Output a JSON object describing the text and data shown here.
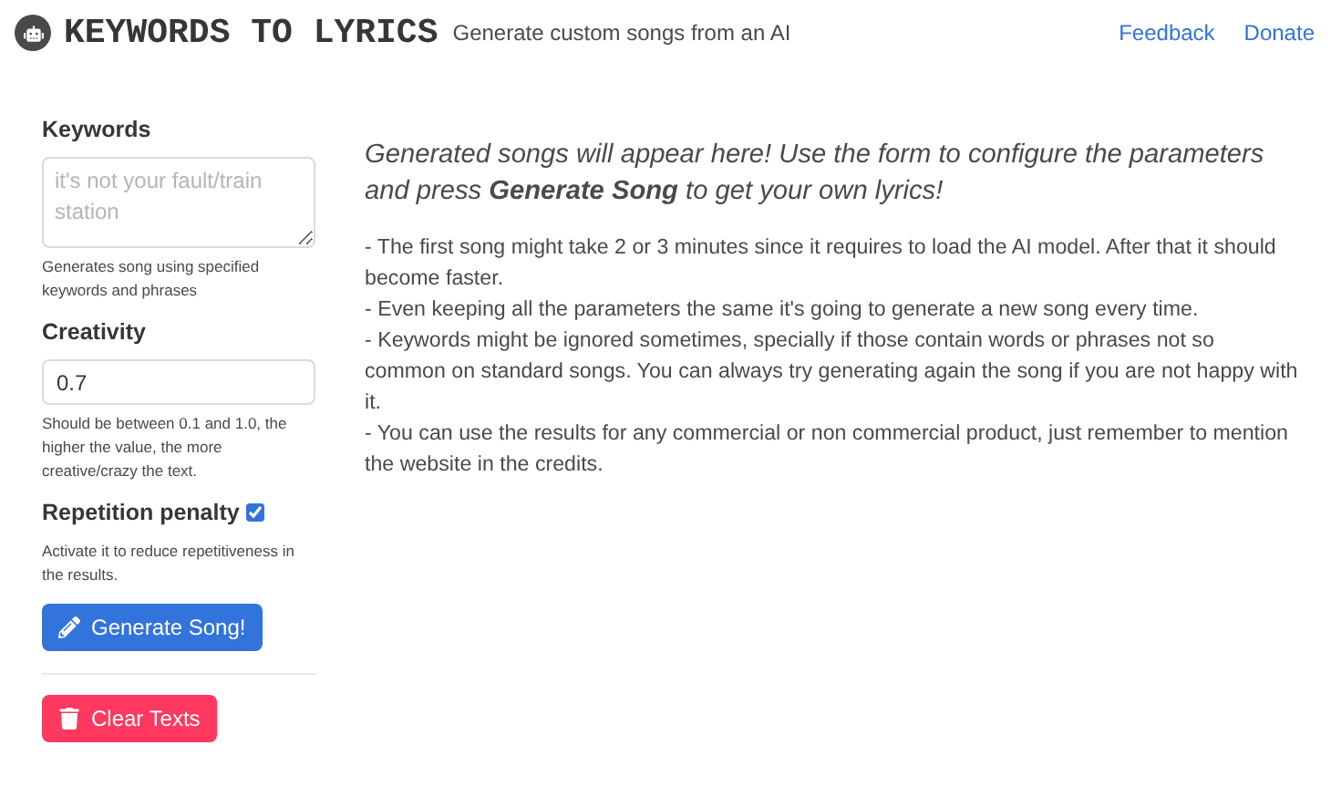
{
  "header": {
    "title": "KEYWORDS TO LYRICS",
    "subtitle": "Generate custom songs from an AI",
    "links": [
      "Feedback",
      "Donate"
    ]
  },
  "form": {
    "keywords": {
      "label": "Keywords",
      "placeholder": "it's not your fault/train station",
      "help": "Generates song using specified keywords and phrases"
    },
    "creativity": {
      "label": "Creativity",
      "value": "0.7",
      "help": "Should be between 0.1 and 1.0, the higher the value, the more creative/crazy the text."
    },
    "repetition": {
      "label": "Repetition penalty",
      "checked": true,
      "help": "Activate it to reduce repetitiveness in the results."
    },
    "generate_button": "Generate Song!",
    "clear_button": "Clear Texts"
  },
  "main": {
    "intro": "Generated songs will appear here! Use the form to configure the parameters and press **Generate Song** to get your own lyrics!",
    "notes": [
      "- The first song might take 2 or 3 minutes since it requires to load the AI model. After that it should become faster.",
      "- Even keeping all the parameters the same it's going to generate a new song every time.",
      "- Keywords might be ignored sometimes, specially if those contain words or phrases not so common on standard songs. You can always try generating again the song if you are not happy with it.",
      "- You can use the results for any commercial or non commercial product, just remember to mention the website in the credits."
    ]
  }
}
